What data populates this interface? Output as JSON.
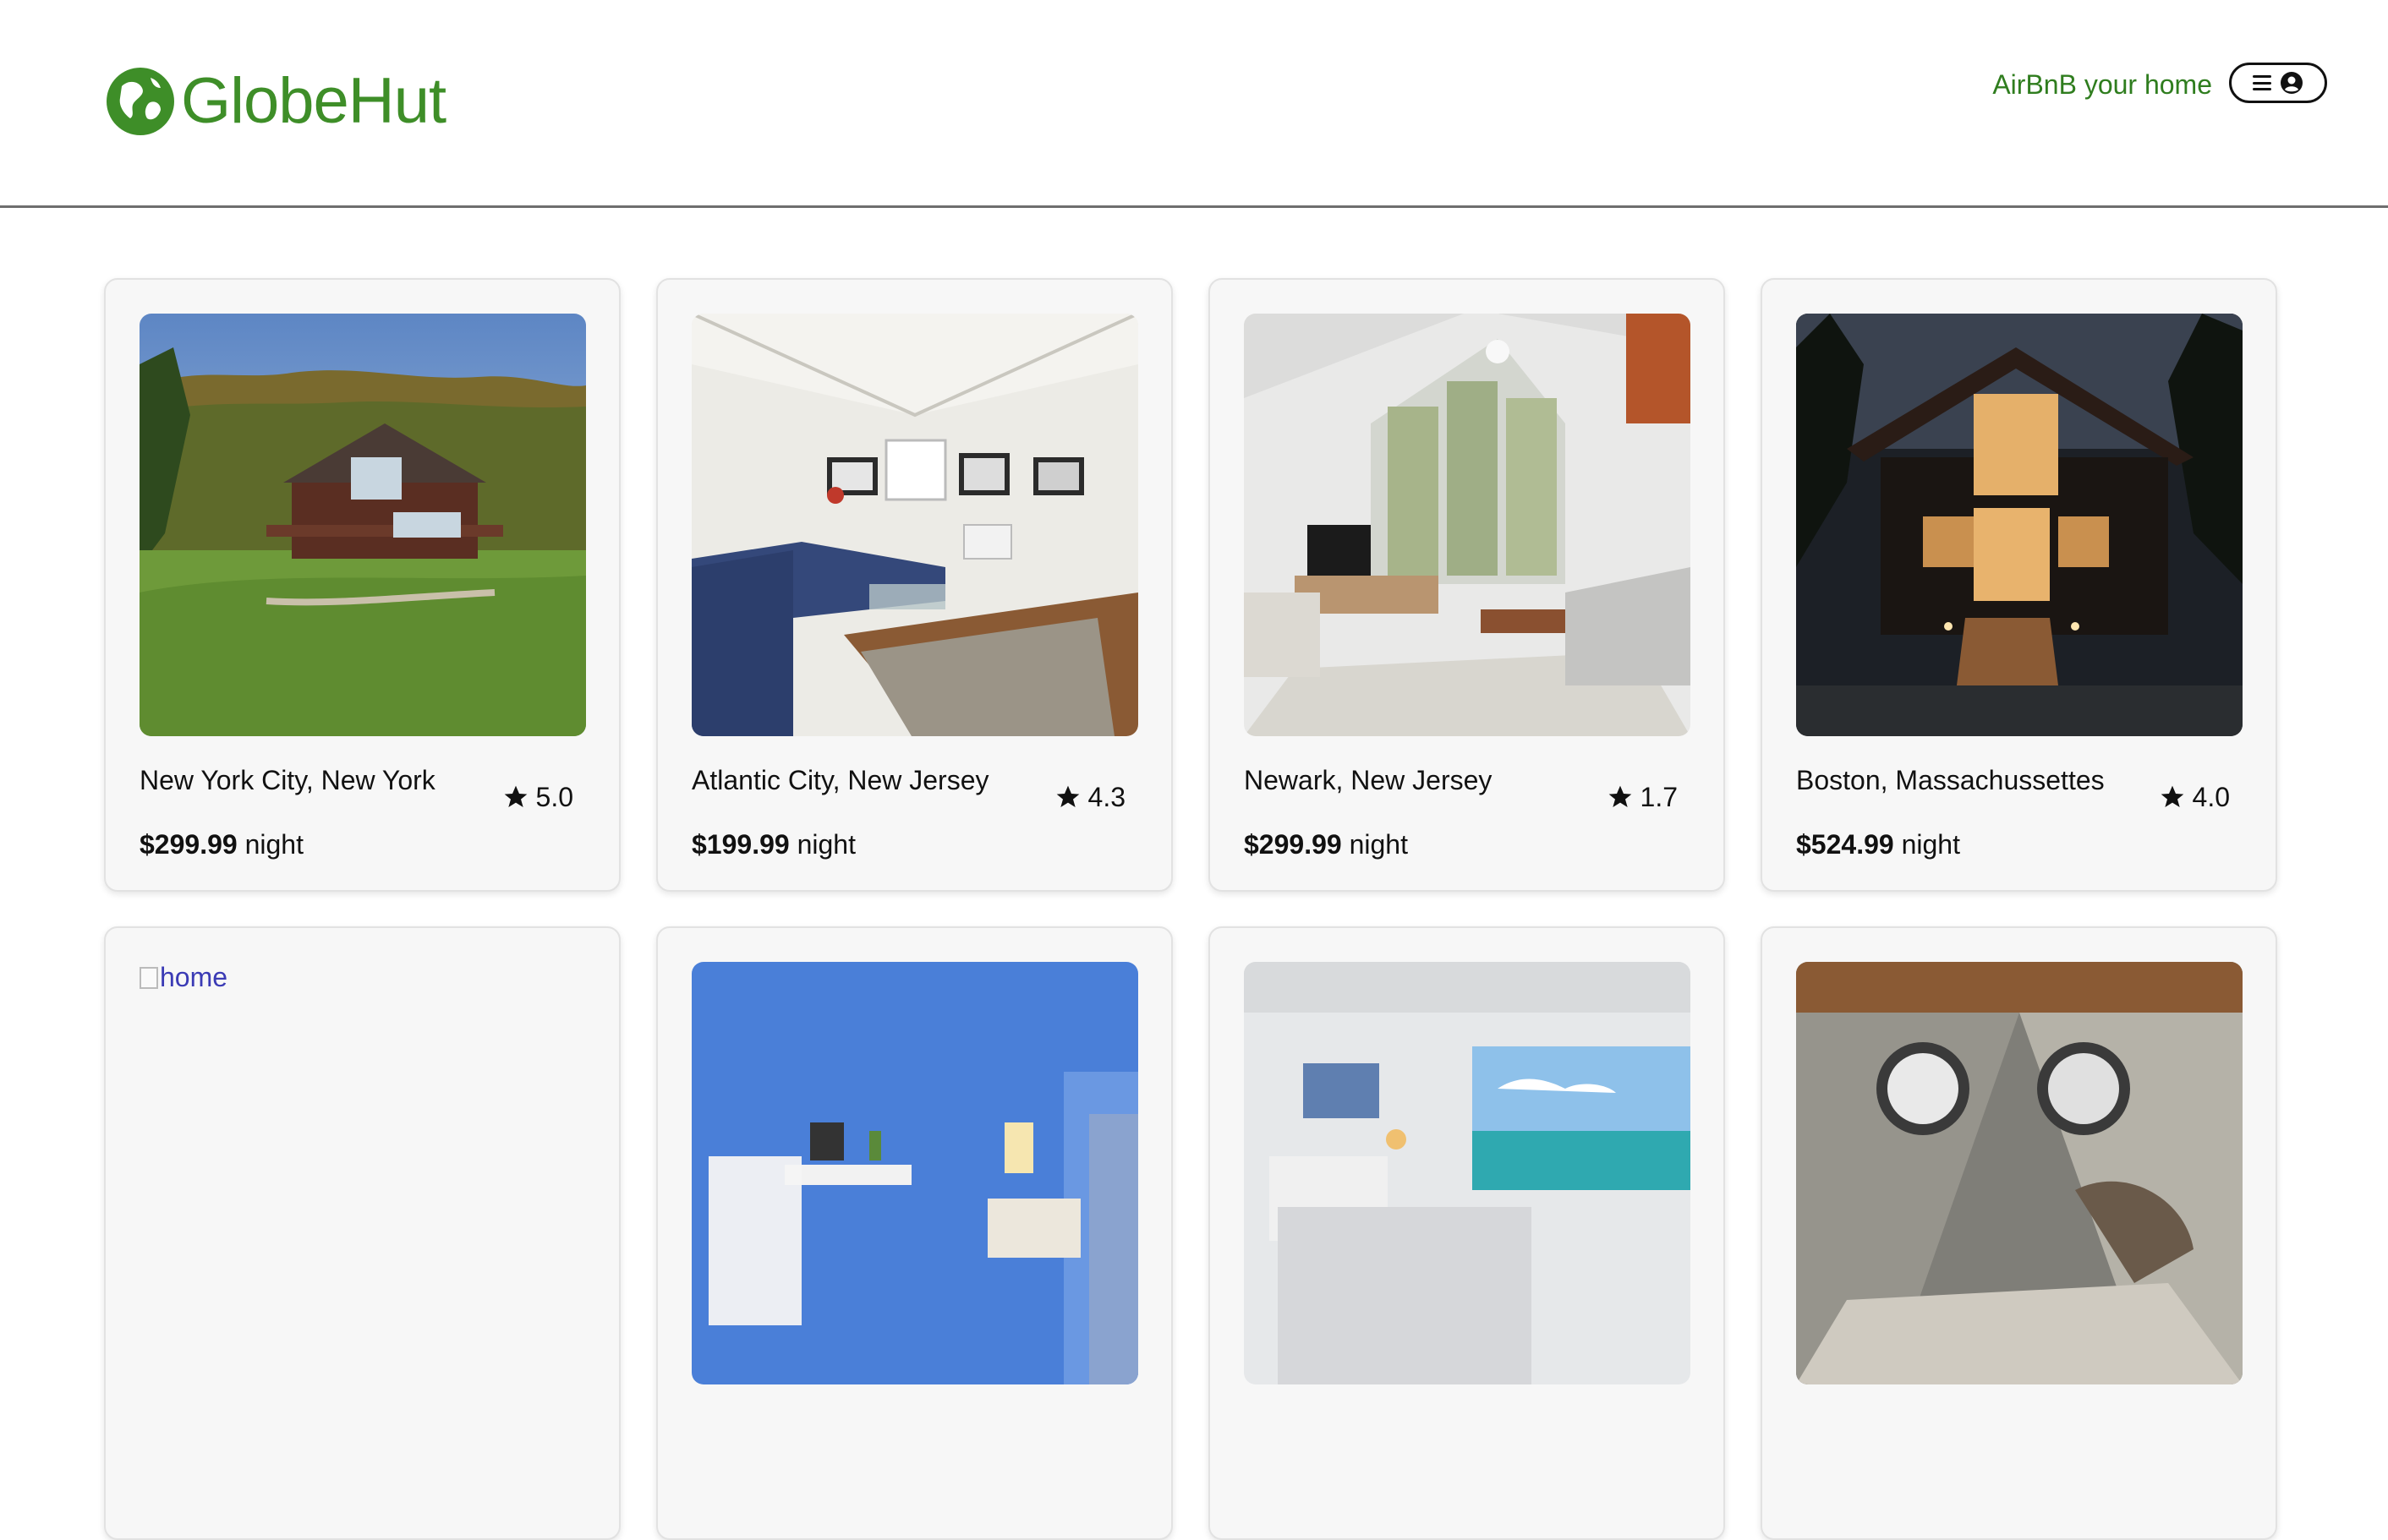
{
  "brand": {
    "name": "GlobeHut",
    "color": "#3e8e28"
  },
  "header": {
    "host_link": "AirBnB your home"
  },
  "listings": [
    {
      "location": "New York City, New York",
      "rating": "5.0",
      "price": "$299.99",
      "unit": "night",
      "image": "lake-house-photo"
    },
    {
      "location": "Atlantic City, New Jersey",
      "rating": "4.3",
      "price": "$199.99",
      "unit": "night",
      "image": "blue-sofa-living-room-photo"
    },
    {
      "location": "Newark, New Jersey",
      "rating": "1.7",
      "price": "$299.99",
      "unit": "night",
      "image": "bright-living-room-photo"
    },
    {
      "location": "Boston, Massachussettes",
      "rating": "4.0",
      "price": "$524.99",
      "unit": "night",
      "image": "cabin-at-night-photo"
    },
    {
      "broken_alt": "home"
    },
    {
      "image": "blue-desk-room-photo"
    },
    {
      "image": "ocean-view-bedroom-photo"
    },
    {
      "image": "porthole-bedroom-photo"
    }
  ]
}
